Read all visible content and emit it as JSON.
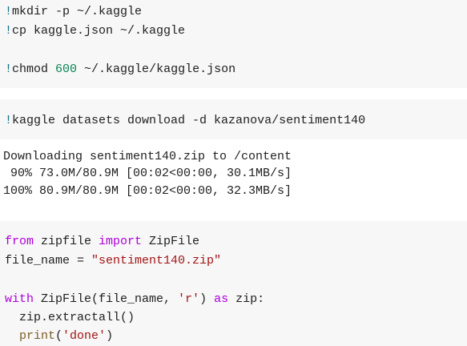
{
  "cell1": {
    "line1": {
      "bang": "!",
      "rest": "mkdir -p ~/.kaggle"
    },
    "line2": {
      "bang": "!",
      "rest": "cp kaggle.json ~/.kaggle"
    },
    "line3": {
      "bang": "!",
      "cmd": "chmod ",
      "num": "600",
      "rest": " ~/.kaggle/kaggle.json"
    }
  },
  "cell2": {
    "line1": {
      "bang": "!",
      "rest": "kaggle datasets download -d kazanova/sentiment140"
    }
  },
  "output2": {
    "lines": [
      "Downloading sentiment140.zip to /content",
      " 90% 73.0M/80.9M [00:02<00:00, 30.1MB/s]",
      "100% 80.9M/80.9M [00:02<00:00, 32.3MB/s]"
    ]
  },
  "cell3": {
    "line1": {
      "kw1": "from",
      "mod": " zipfile ",
      "kw2": "import",
      "name": " ZipFile"
    },
    "line2": {
      "var": "file_name = ",
      "str": "\"sentiment140.zip\""
    },
    "line3": {
      "kw": "with",
      "call": " ZipFile(file_name, ",
      "str": "'r'",
      "close": ") ",
      "kw2": "as",
      "rest": " zip:"
    },
    "line4": {
      "text": "  zip.extractall()"
    },
    "line5": {
      "indent": "  ",
      "fn": "print",
      "open": "(",
      "str": "'done'",
      "close": ")"
    }
  }
}
